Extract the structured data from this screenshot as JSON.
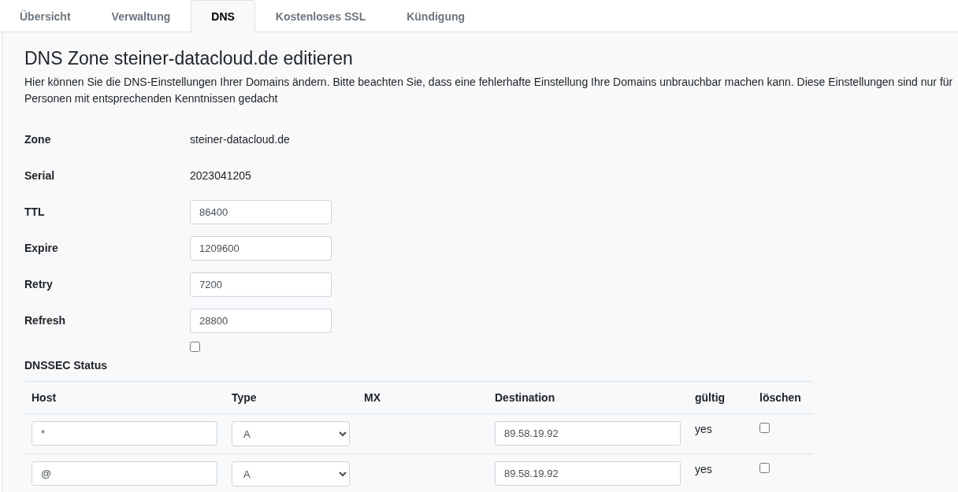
{
  "tabs": [
    {
      "label": "Übersicht",
      "selected": false
    },
    {
      "label": "Verwaltung",
      "selected": false
    },
    {
      "label": "DNS",
      "selected": true
    },
    {
      "label": "Kostenloses SSL",
      "selected": false
    },
    {
      "label": "Kündigung",
      "selected": false
    }
  ],
  "heading": "DNS Zone steiner-datacloud.de editieren",
  "description": "Hier können Sie die DNS-Einstellungen Ihrer Domains ändern. Bitte beachten Sie, dass eine fehlerhafte Einstellung Ihre Domains unbrauchbar machen kann. Diese Einstellungen sind nur für Personen mit entsprechenden Kenntnissen gedacht",
  "zone_fields": [
    {
      "kind": "text",
      "label": "Zone",
      "value": "steiner-datacloud.de"
    },
    {
      "kind": "text",
      "label": "Serial",
      "value": "2023041205"
    },
    {
      "kind": "input",
      "label": "TTL",
      "value": "86400"
    },
    {
      "kind": "input",
      "label": "Expire",
      "value": "1209600"
    },
    {
      "kind": "input",
      "label": "Retry",
      "value": "7200"
    },
    {
      "kind": "input",
      "label": "Refresh",
      "value": "28800"
    },
    {
      "kind": "checkbox",
      "label": "DNSSEC Status",
      "checked": false
    }
  ],
  "records": {
    "columns": [
      "Host",
      "Type",
      "MX",
      "Destination",
      "gültig",
      "löschen"
    ],
    "rows": [
      {
        "host": "*",
        "type": "A",
        "destination": "89.58.19.92",
        "valid": "yes",
        "delete": false
      },
      {
        "host": "@",
        "type": "A",
        "destination": "89.58.19.92",
        "valid": "yes",
        "delete": false
      }
    ]
  }
}
